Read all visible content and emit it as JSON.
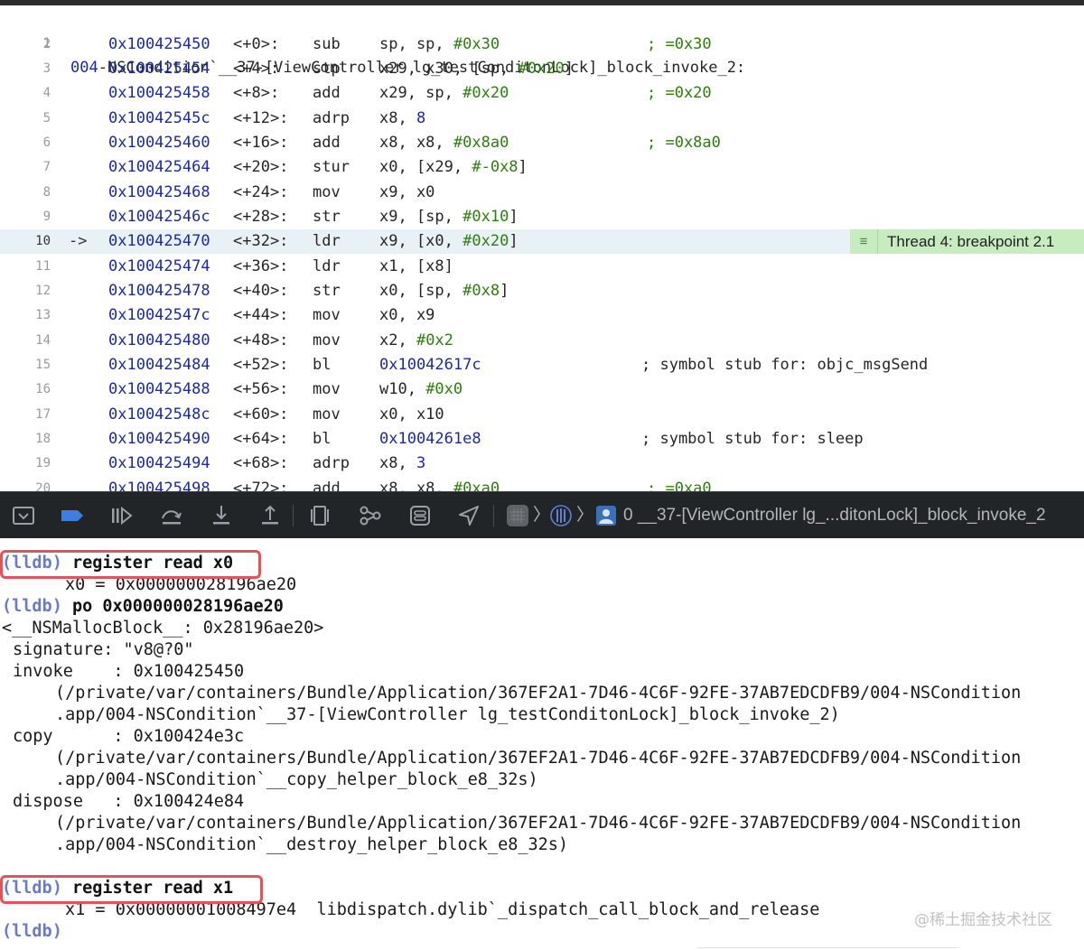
{
  "disassembly": {
    "header": {
      "line": "1",
      "lead": "004",
      "rest": "-NSCondition`__37-[ViewController lg_testConditonLock]_block_invoke_2:"
    },
    "rows": [
      {
        "line": "2",
        "arrow": "",
        "addr": "0x100425450",
        "off": "<+0>:",
        "mn": "sub",
        "ops": [
          {
            "t": "sp, sp, ",
            "c": ""
          },
          {
            "t": "#0x30",
            "c": "num"
          }
        ],
        "cmt": "; =0x30",
        "cmtc": "num",
        "cmtx": 716
      },
      {
        "line": "3",
        "arrow": "",
        "addr": "0x100425454",
        "off": "<+4>:",
        "mn": "stp",
        "ops": [
          {
            "t": "x29, x30, [sp, ",
            "c": ""
          },
          {
            "t": "#0x20",
            "c": "num"
          },
          {
            "t": "]",
            "c": ""
          }
        ],
        "cmt": "",
        "cmtc": "",
        "cmtx": 0
      },
      {
        "line": "4",
        "arrow": "",
        "addr": "0x100425458",
        "off": "<+8>:",
        "mn": "add",
        "ops": [
          {
            "t": "x29, sp, ",
            "c": ""
          },
          {
            "t": "#0x20",
            "c": "num"
          }
        ],
        "cmt": "; =0x20",
        "cmtc": "num",
        "cmtx": 716
      },
      {
        "line": "5",
        "arrow": "",
        "addr": "0x10042545c",
        "off": "<+12>:",
        "mn": "adrp",
        "ops": [
          {
            "t": "x8, ",
            "c": ""
          },
          {
            "t": "8",
            "c": "hex"
          }
        ],
        "cmt": "",
        "cmtc": "",
        "cmtx": 0
      },
      {
        "line": "6",
        "arrow": "",
        "addr": "0x100425460",
        "off": "<+16>:",
        "mn": "add",
        "ops": [
          {
            "t": "x8, x8, ",
            "c": ""
          },
          {
            "t": "#0x8a0",
            "c": "num"
          }
        ],
        "cmt": "; =0x8a0",
        "cmtc": "num",
        "cmtx": 716
      },
      {
        "line": "7",
        "arrow": "",
        "addr": "0x100425464",
        "off": "<+20>:",
        "mn": "stur",
        "ops": [
          {
            "t": "x0, [x29, ",
            "c": ""
          },
          {
            "t": "#-0x8",
            "c": "num"
          },
          {
            "t": "]",
            "c": ""
          }
        ],
        "cmt": "",
        "cmtc": "",
        "cmtx": 0
      },
      {
        "line": "8",
        "arrow": "",
        "addr": "0x100425468",
        "off": "<+24>:",
        "mn": "mov",
        "ops": [
          {
            "t": "x9, x0",
            "c": ""
          }
        ],
        "cmt": "",
        "cmtc": "",
        "cmtx": 0
      },
      {
        "line": "9",
        "arrow": "",
        "addr": "0x10042546c",
        "off": "<+28>:",
        "mn": "str",
        "ops": [
          {
            "t": "x9, [sp, ",
            "c": ""
          },
          {
            "t": "#0x10",
            "c": "num"
          },
          {
            "t": "]",
            "c": ""
          }
        ],
        "cmt": "",
        "cmtc": "",
        "cmtx": 0
      },
      {
        "line": "10",
        "arrow": "->",
        "addr": "0x100425470",
        "off": "<+32>:",
        "mn": "ldr",
        "ops": [
          {
            "t": "x9, [x0, ",
            "c": ""
          },
          {
            "t": "#0x20",
            "c": "num"
          },
          {
            "t": "]",
            "c": ""
          }
        ],
        "cmt": "",
        "cmtc": "",
        "cmtx": 0,
        "current": true
      },
      {
        "line": "11",
        "arrow": "",
        "addr": "0x100425474",
        "off": "<+36>:",
        "mn": "ldr",
        "ops": [
          {
            "t": "x1, [x8]",
            "c": ""
          }
        ],
        "cmt": "",
        "cmtc": "",
        "cmtx": 0
      },
      {
        "line": "12",
        "arrow": "",
        "addr": "0x100425478",
        "off": "<+40>:",
        "mn": "str",
        "ops": [
          {
            "t": "x0, [sp, ",
            "c": ""
          },
          {
            "t": "#0x8",
            "c": "num"
          },
          {
            "t": "]",
            "c": ""
          }
        ],
        "cmt": "",
        "cmtc": "",
        "cmtx": 0
      },
      {
        "line": "13",
        "arrow": "",
        "addr": "0x10042547c",
        "off": "<+44>:",
        "mn": "mov",
        "ops": [
          {
            "t": "x0, x9",
            "c": ""
          }
        ],
        "cmt": "",
        "cmtc": "",
        "cmtx": 0
      },
      {
        "line": "14",
        "arrow": "",
        "addr": "0x100425480",
        "off": "<+48>:",
        "mn": "mov",
        "ops": [
          {
            "t": "x2, ",
            "c": ""
          },
          {
            "t": "#0x2",
            "c": "num"
          }
        ],
        "cmt": "",
        "cmtc": "",
        "cmtx": 0
      },
      {
        "line": "15",
        "arrow": "",
        "addr": "0x100425484",
        "off": "<+52>:",
        "mn": "bl",
        "ops": [
          {
            "t": "0x10042617c",
            "c": "hex"
          }
        ],
        "cmt": "; symbol stub for: objc_msgSend",
        "cmtc": "",
        "cmtx": 710
      },
      {
        "line": "16",
        "arrow": "",
        "addr": "0x100425488",
        "off": "<+56>:",
        "mn": "mov",
        "ops": [
          {
            "t": "w10, ",
            "c": ""
          },
          {
            "t": "#0x0",
            "c": "num"
          }
        ],
        "cmt": "",
        "cmtc": "",
        "cmtx": 0
      },
      {
        "line": "17",
        "arrow": "",
        "addr": "0x10042548c",
        "off": "<+60>:",
        "mn": "mov",
        "ops": [
          {
            "t": "x0, x10",
            "c": ""
          }
        ],
        "cmt": "",
        "cmtc": "",
        "cmtx": 0
      },
      {
        "line": "18",
        "arrow": "",
        "addr": "0x100425490",
        "off": "<+64>:",
        "mn": "bl",
        "ops": [
          {
            "t": "0x1004261e8",
            "c": "hex"
          }
        ],
        "cmt": "; symbol stub for: sleep",
        "cmtc": "",
        "cmtx": 710
      },
      {
        "line": "19",
        "arrow": "",
        "addr": "0x100425494",
        "off": "<+68>:",
        "mn": "adrp",
        "ops": [
          {
            "t": "x8, ",
            "c": ""
          },
          {
            "t": "3",
            "c": "hex"
          }
        ],
        "cmt": "",
        "cmtc": "",
        "cmtx": 0
      },
      {
        "line": "20",
        "arrow": "",
        "addr": "0x100425498",
        "off": "<+72>:",
        "mn": "add",
        "ops": [
          {
            "t": "x8, x8, ",
            "c": ""
          },
          {
            "t": "#0xa0",
            "c": "num"
          }
        ],
        "cmt": "; =0xa0",
        "cmtc": "num",
        "cmtx": 716
      }
    ],
    "breakpoint_label": "Thread 4: breakpoint 2.1"
  },
  "toolbar": {
    "breadcrumb_frame": "0 __37-[ViewController lg_...ditonLock]_block_invoke_2"
  },
  "console": {
    "lines": [
      {
        "parts": [
          {
            "t": "(lldb)",
            "c": "prompt"
          },
          {
            "t": " register read x0",
            "c": "cmd"
          }
        ],
        "x": 2
      },
      {
        "parts": [
          {
            "t": "x0 = 0x000000028196ae20",
            "c": ""
          }
        ],
        "x": 72
      },
      {
        "parts": [
          {
            "t": "(lldb)",
            "c": "prompt"
          },
          {
            "t": " po 0x000000028196ae20",
            "c": "cmd"
          }
        ],
        "x": 2
      },
      {
        "parts": [
          {
            "t": "<__NSMallocBlock__: 0x28196ae20>",
            "c": ""
          }
        ],
        "x": 2
      },
      {
        "parts": [
          {
            "t": "signature: \"v8@?0\"",
            "c": ""
          }
        ],
        "x": 14
      },
      {
        "parts": [
          {
            "t": "invoke    : 0x100425450",
            "c": ""
          }
        ],
        "x": 14
      },
      {
        "parts": [
          {
            "t": "(/private/var/containers/Bundle/Application/367EF2A1-7D46-4C6F-92FE-37AB7EDCDFB9/004-NSCondition",
            "c": ""
          }
        ],
        "x": 61
      },
      {
        "parts": [
          {
            "t": ".app/004-NSCondition`__37-[ViewController lg_testConditonLock]_block_invoke_2)",
            "c": ""
          }
        ],
        "x": 61
      },
      {
        "parts": [
          {
            "t": "copy      : 0x100424e3c",
            "c": ""
          }
        ],
        "x": 14
      },
      {
        "parts": [
          {
            "t": "(/private/var/containers/Bundle/Application/367EF2A1-7D46-4C6F-92FE-37AB7EDCDFB9/004-NSCondition",
            "c": ""
          }
        ],
        "x": 61
      },
      {
        "parts": [
          {
            "t": ".app/004-NSCondition`__copy_helper_block_e8_32s)",
            "c": ""
          }
        ],
        "x": 61
      },
      {
        "parts": [
          {
            "t": "dispose   : 0x100424e84",
            "c": ""
          }
        ],
        "x": 14
      },
      {
        "parts": [
          {
            "t": "(/private/var/containers/Bundle/Application/367EF2A1-7D46-4C6F-92FE-37AB7EDCDFB9/004-NSCondition",
            "c": ""
          }
        ],
        "x": 61
      },
      {
        "parts": [
          {
            "t": ".app/004-NSCondition`__destroy_helper_block_e8_32s)",
            "c": ""
          }
        ],
        "x": 61
      },
      {
        "parts": [
          {
            "t": "",
            "c": ""
          }
        ],
        "x": 2
      },
      {
        "parts": [
          {
            "t": "(lldb)",
            "c": "prompt"
          },
          {
            "t": " register read x1",
            "c": "cmd"
          }
        ],
        "x": 2
      },
      {
        "parts": [
          {
            "t": "x1 = 0x00000001008497e4  libdispatch.dylib`_dispatch_call_block_and_release",
            "c": ""
          }
        ],
        "x": 72
      },
      {
        "parts": [
          {
            "t": "(lldb)",
            "c": "prompt"
          }
        ],
        "x": 2
      }
    ],
    "watermark": "@稀土掘金技术社区"
  }
}
